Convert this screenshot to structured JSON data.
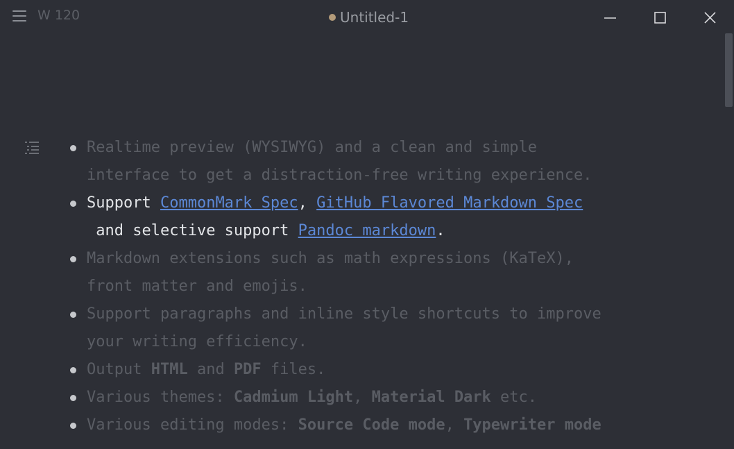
{
  "window": {
    "title": "Untitled-1",
    "word_count": "W 120",
    "unsaved": true,
    "controls": [
      "minimize-icon",
      "maximize-icon",
      "close-icon"
    ]
  },
  "colors": {
    "background": "#2d2f36",
    "link": "#5c88d6",
    "unsaved_dot": "#b39b7a",
    "dim_text": "#5a5d64",
    "active_text": "#e3e5e8"
  },
  "editor": {
    "items": [
      {
        "t1": "Realtime preview (WYSIWYG) and a clean and simple",
        "t2": "interface to get a distraction-free writing experience."
      },
      {
        "a": "Support ",
        "link1": "CommonMark Spec",
        "b": ", ",
        "link2": "GitHub Flavored Markdown Spec",
        "c": " and selective support ",
        "link3": "Pandoc markdown",
        "d": "."
      },
      {
        "t1": "Markdown extensions such as math expressions (KaTeX),",
        "t2": "front matter and emojis."
      },
      {
        "t1": "Support paragraphs and inline style shortcuts to improve",
        "t2": "your writing efficiency."
      },
      {
        "a": "Output ",
        "b1": "HTML",
        "c": " and ",
        "b2": "PDF",
        "d": " files."
      },
      {
        "a": "Various themes: ",
        "b1": "Cadmium Light",
        "c": ", ",
        "b2": "Material Dark",
        "d": " etc."
      },
      {
        "a": "Various editing modes: ",
        "b1": "Source Code mode",
        "c": ", ",
        "b2": "Typewriter mode"
      }
    ]
  }
}
